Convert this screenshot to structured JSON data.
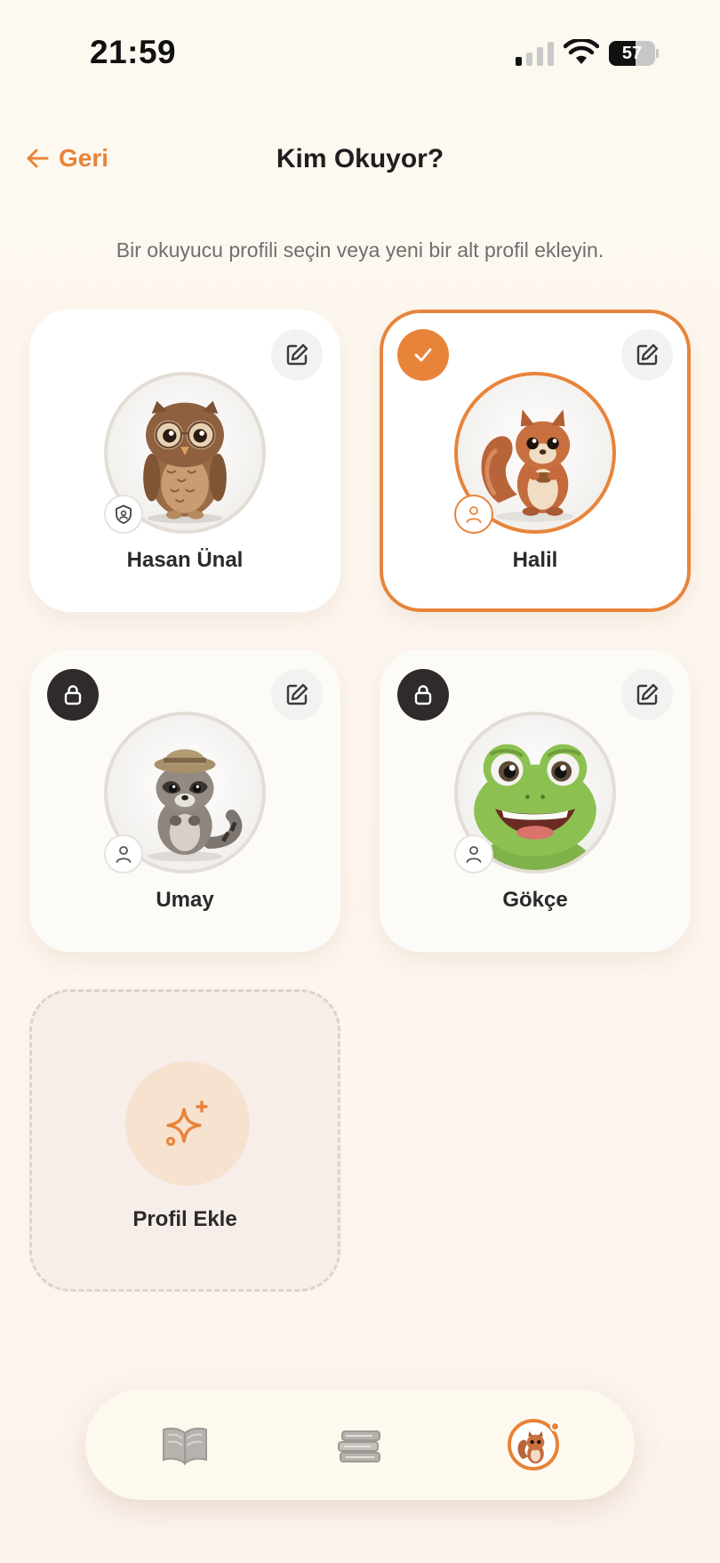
{
  "status_bar": {
    "time": "21:59",
    "battery_level": "57",
    "battery_percent": 57,
    "signal_bars_active": 1
  },
  "nav": {
    "back_label": "Geri",
    "title": "Kim Okuyor?"
  },
  "subtitle": "Bir okuyucu profili seçin veya yeni bir alt profil ekleyin.",
  "profiles": [
    {
      "name": "Hasan Ünal",
      "avatar": "owl",
      "role_icon": "shield-icon",
      "selected": false,
      "locked": false
    },
    {
      "name": "Halil",
      "avatar": "squirrel",
      "role_icon": "person-icon",
      "selected": true,
      "locked": false
    },
    {
      "name": "Umay",
      "avatar": "raccoon",
      "role_icon": "person-icon",
      "selected": false,
      "locked": true
    },
    {
      "name": "Gökçe",
      "avatar": "frog",
      "role_icon": "person-icon",
      "selected": false,
      "locked": true
    }
  ],
  "add_profile": {
    "label": "Profil Ekle",
    "icon": "sparkle-icon"
  },
  "tab_bar": {
    "tabs": [
      {
        "icon": "open-book-icon",
        "active": false
      },
      {
        "icon": "book-stack-icon",
        "active": false
      },
      {
        "icon": "profile-avatar-icon",
        "active": true,
        "has_notification_dot": true
      }
    ]
  },
  "colors": {
    "accent": "#e8843a",
    "lock_badge": "#2e2b2a",
    "background": "#fdf8f0"
  }
}
